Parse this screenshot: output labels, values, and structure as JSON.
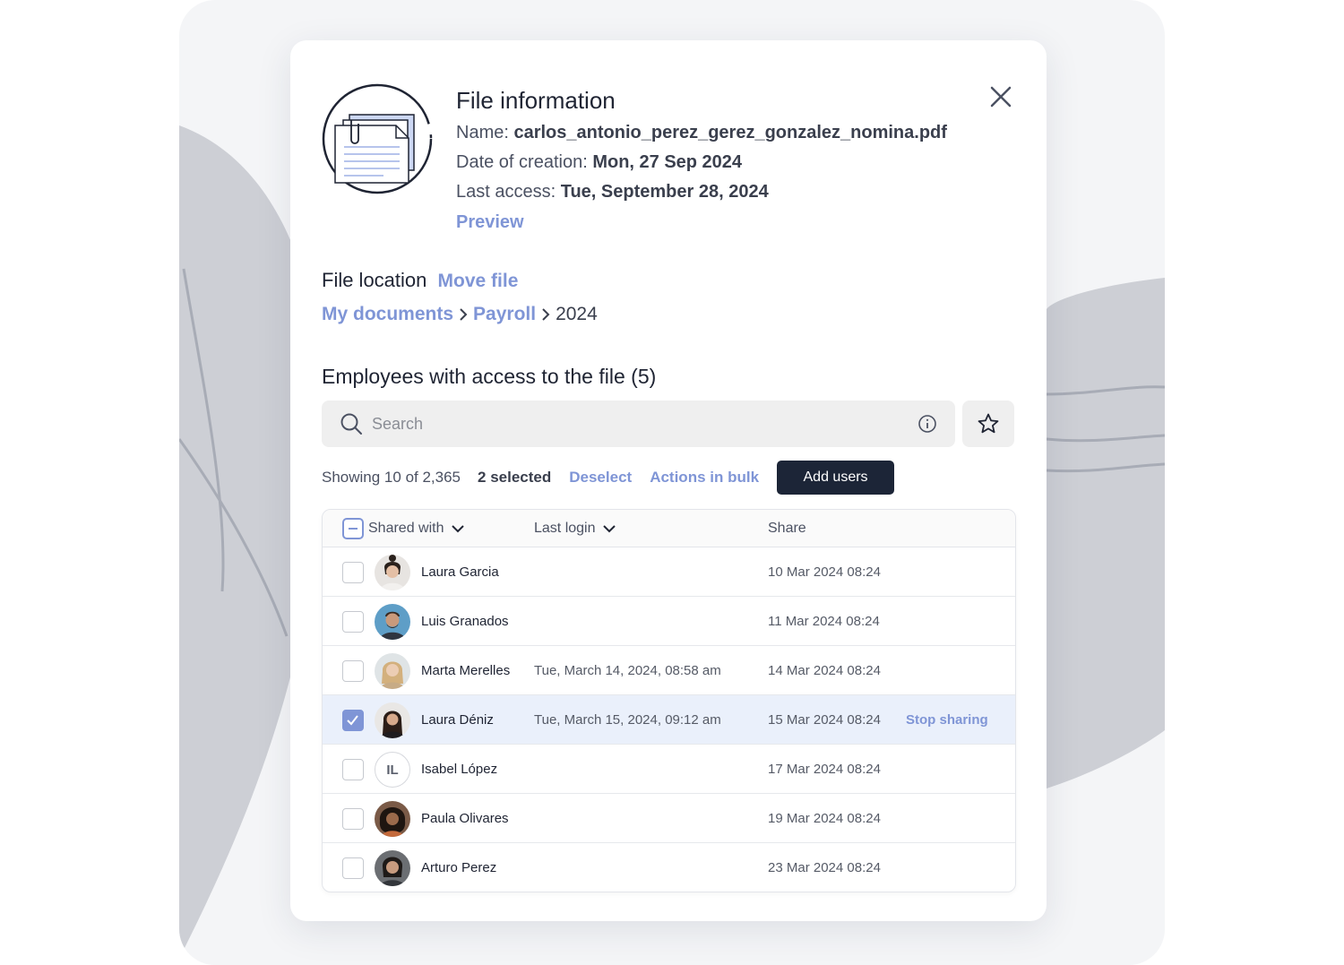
{
  "modal": {
    "title": "File information",
    "name_label": "Name:",
    "name_value": "carlos_antonio_perez_gerez_gonzalez_nomina.pdf",
    "date_label": "Date of creation:",
    "date_value": "Mon, 27 Sep 2024",
    "access_label": "Last access:",
    "access_value": "Tue, September 28, 2024",
    "preview_link": "Preview"
  },
  "location": {
    "title": "File location",
    "move_link": "Move file",
    "breadcrumb": [
      "My documents",
      "Payroll",
      "2024"
    ]
  },
  "employees": {
    "title": "Employees with access to the file (5)",
    "search_placeholder": "Search",
    "showing": "Showing 10 of 2,365",
    "selected": "2 selected",
    "deselect": "Deselect",
    "bulk": "Actions in bulk",
    "add_users": "Add users"
  },
  "table": {
    "columns": [
      "Shared with",
      "Last login",
      "Share"
    ],
    "rows": [
      {
        "name": "Laura Garcia",
        "last_login": "",
        "share": "10 Mar 2024 08:24",
        "selected": false
      },
      {
        "name": "Luis Granados",
        "last_login": "",
        "share": "11 Mar 2024 08:24",
        "selected": false
      },
      {
        "name": "Marta Merelles",
        "last_login": "Tue, March 14, 2024, 08:58 am",
        "share": "14 Mar 2024 08:24",
        "selected": false
      },
      {
        "name": "Laura Déniz",
        "last_login": "Tue, March 15, 2024, 09:12 am",
        "share": "15 Mar 2024 08:24",
        "selected": true,
        "action": "Stop sharing"
      },
      {
        "name": "Isabel López",
        "initials": "IL",
        "last_login": "",
        "share": "17 Mar 2024 08:24",
        "selected": false
      },
      {
        "name": "Paula Olivares",
        "last_login": "",
        "share": "19 Mar 2024 08:24",
        "selected": false
      },
      {
        "name": "Arturo Perez",
        "last_login": "",
        "share": "23 Mar 2024 08:24",
        "selected": false
      }
    ]
  },
  "colors": {
    "accent": "#7f95d6",
    "dark_button": "#1c2537",
    "selected_row": "#eaf0fb"
  }
}
